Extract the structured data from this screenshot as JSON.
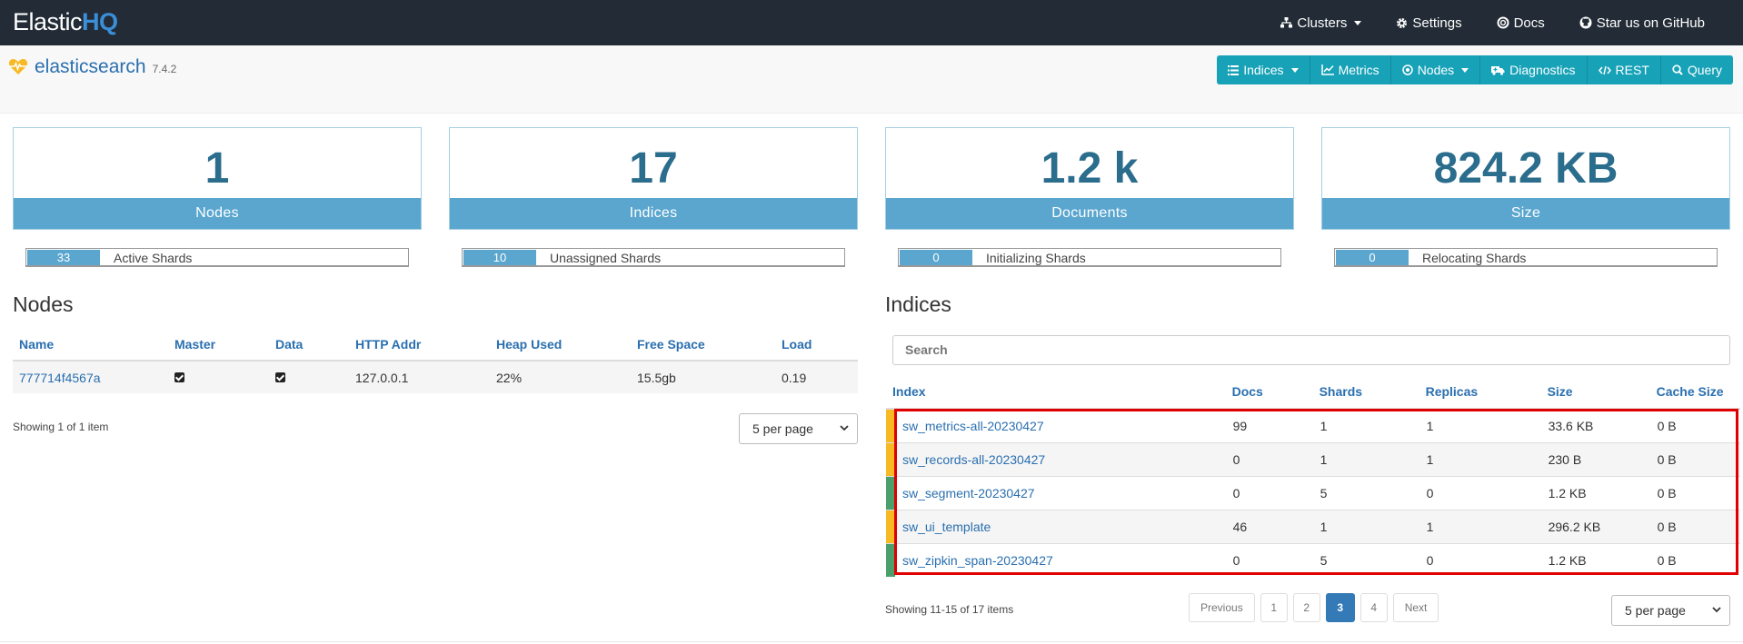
{
  "app": {
    "brand_main": "Elastic",
    "brand_hq": "HQ"
  },
  "nav": {
    "clusters": "Clusters",
    "settings": "Settings",
    "docs": "Docs",
    "github": "Star us on GitHub"
  },
  "cluster": {
    "name": "elasticsearch",
    "version": "7.4.2"
  },
  "toolbar": {
    "indices": "Indices",
    "metrics": "Metrics",
    "nodes": "Nodes",
    "diagnostics": "Diagnostics",
    "rest": "REST",
    "query": "Query"
  },
  "stats": {
    "nodes": {
      "value": "1",
      "label": "Nodes"
    },
    "indices": {
      "value": "17",
      "label": "Indices"
    },
    "documents": {
      "value": "1.2 k",
      "label": "Documents"
    },
    "size": {
      "value": "824.2 KB",
      "label": "Size"
    }
  },
  "shards": {
    "active": {
      "value": "33",
      "label": "Active Shards"
    },
    "unassigned": {
      "value": "10",
      "label": "Unassigned Shards"
    },
    "initializing": {
      "value": "0",
      "label": "Initializing Shards"
    },
    "relocating": {
      "value": "0",
      "label": "Relocating Shards"
    }
  },
  "nodes_section": {
    "title": "Nodes",
    "headers": [
      "Name",
      "Master",
      "Data",
      "HTTP Addr",
      "Heap Used",
      "Free Space",
      "Load"
    ],
    "rows": [
      {
        "name": "777714f4567a",
        "http": "127.0.0.1",
        "heap": "22%",
        "free": "15.5gb",
        "load": "0.19"
      }
    ],
    "showing": "Showing 1 of 1 item",
    "per_page": "5 per page"
  },
  "indices_section": {
    "title": "Indices",
    "search_placeholder": "Search",
    "headers": [
      "Index",
      "Docs",
      "Shards",
      "Replicas",
      "Size",
      "Cache Size"
    ],
    "rows": [
      {
        "index": "sw_metrics-all-20230427",
        "docs": "99",
        "shards": "1",
        "replicas": "1",
        "size": "33.6 KB",
        "cache": "0 B",
        "health": "yellow"
      },
      {
        "index": "sw_records-all-20230427",
        "docs": "0",
        "shards": "1",
        "replicas": "1",
        "size": "230 B",
        "cache": "0 B",
        "health": "yellow"
      },
      {
        "index": "sw_segment-20230427",
        "docs": "0",
        "shards": "5",
        "replicas": "0",
        "size": "1.2 KB",
        "cache": "0 B",
        "health": "green"
      },
      {
        "index": "sw_ui_template",
        "docs": "46",
        "shards": "1",
        "replicas": "1",
        "size": "296.2 KB",
        "cache": "0 B",
        "health": "yellow"
      },
      {
        "index": "sw_zipkin_span-20230427",
        "docs": "0",
        "shards": "5",
        "replicas": "0",
        "size": "1.2 KB",
        "cache": "0 B",
        "health": "green"
      }
    ],
    "showing": "Showing 11-15 of 17 items",
    "per_page": "5 per page",
    "pager": {
      "previous": "Previous",
      "p1": "1",
      "p2": "2",
      "p3": "3",
      "p4": "4",
      "next": "Next"
    }
  },
  "colors": {
    "navbar": "#222b36",
    "accent": "#17a2b8",
    "stat_label": "#5aa6cf",
    "health_yellow": "#f7b924",
    "health_green": "#4a9f6a",
    "highlight": "#e00000"
  }
}
